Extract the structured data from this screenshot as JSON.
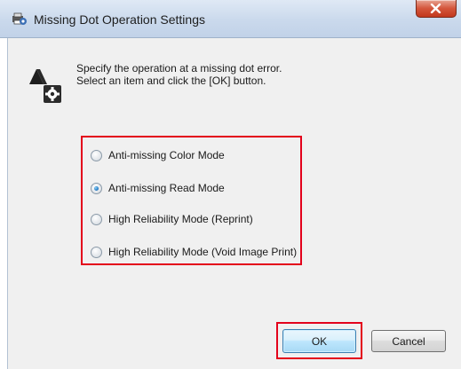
{
  "window": {
    "title": "Missing Dot Operation Settings",
    "icon": "printer-settings-icon",
    "close_icon": "close-icon"
  },
  "description": {
    "icon": "settings-info-icon",
    "line1": "Specify the operation at a missing dot error.",
    "line2": "Select an item and click the [OK] button."
  },
  "options": [
    {
      "label": "Anti-missing Color Mode",
      "checked": false
    },
    {
      "label": "Anti-missing Read Mode",
      "checked": true
    },
    {
      "label": "High Reliability Mode (Reprint)",
      "checked": false
    },
    {
      "label": "High Reliability Mode (Void Image Print)",
      "checked": false
    }
  ],
  "buttons": {
    "ok": "OK",
    "cancel": "Cancel"
  },
  "colors": {
    "highlight": "#e3001b",
    "titlebar": "#cad9ec",
    "client_bg": "#f0f0f0"
  }
}
